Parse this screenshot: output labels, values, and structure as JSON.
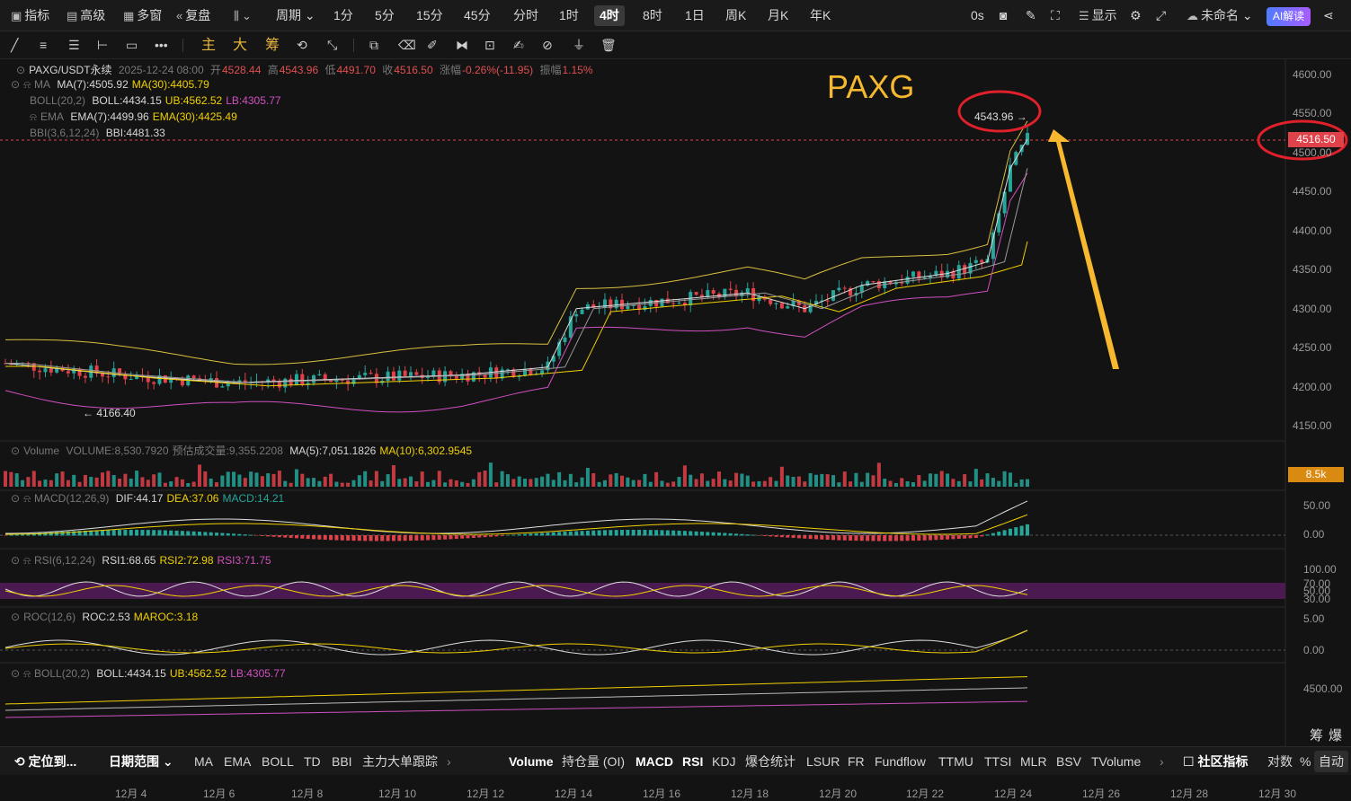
{
  "topbar": {
    "indicators": "指标",
    "advanced": "高级",
    "multi": "多窗",
    "replay": "复盘",
    "period": "周期",
    "intervals": [
      "1分",
      "5分",
      "15分",
      "45分",
      "分时",
      "1时",
      "4时",
      "8时",
      "1日",
      "周K",
      "月K",
      "年K"
    ],
    "active_interval": "4时",
    "zero_s": "0s",
    "display": "显示",
    "layout_name": "未命名",
    "ai": "AI解读"
  },
  "toolbar": {
    "main": "主",
    "big": "大",
    "chip": "筹"
  },
  "header": {
    "symbol": "PAXG/USDT永续",
    "datetime": "2025-12-24 08:00",
    "open_label": "开",
    "open": "4528.44",
    "high_label": "高",
    "high": "4543.96",
    "low_label": "低",
    "low": "4491.70",
    "close_label": "收",
    "close": "4516.50",
    "change_label": "涨幅",
    "change": "-0.26%(-11.95)",
    "amp_label": "振幅",
    "amp": "1.15%"
  },
  "legends": {
    "ma": {
      "name": "MA",
      "ma7": "MA(7):4505.92",
      "ma30": "MA(30):4405.79"
    },
    "boll": {
      "name": "BOLL(20,2)",
      "mid": "BOLL:4434.15",
      "ub": "UB:4562.52",
      "lb": "LB:4305.77"
    },
    "ema": {
      "name": "EMA",
      "ema7": "EMA(7):4499.96",
      "ema30": "EMA(30):4425.49"
    },
    "bbi": {
      "name": "BBI(3,6,12,24)",
      "val": "BBI:4481.33"
    },
    "volume": {
      "name": "Volume",
      "val": "VOLUME:8,530.7920",
      "est": "预估成交量:9,355.2208",
      "ma5": "MA(5):7,051.1826",
      "ma10": "MA(10):6,302.9545"
    },
    "macd": {
      "name": "MACD(12,26,9)",
      "dif": "DIF:44.17",
      "dea": "DEA:37.06",
      "macd": "MACD:14.21"
    },
    "rsi": {
      "name": "RSI(6,12,24)",
      "r1": "RSI1:68.65",
      "r2": "RSI2:72.98",
      "r3": "RSI3:71.75"
    },
    "roc": {
      "name": "ROC(12,6)",
      "roc": "ROC:2.53",
      "maroc": "MAROC:3.18"
    },
    "boll2": {
      "name": "BOLL(20,2)",
      "mid": "BOLL:4434.15",
      "ub": "UB:4562.52",
      "lb": "LB:4305.77"
    }
  },
  "annotation": {
    "label": "PAXG",
    "high_mark": "4543.96",
    "low_mark": "4166.40"
  },
  "price_axis": [
    "4600.00",
    "4550.00",
    "4500.00",
    "4450.00",
    "4400.00",
    "4350.00",
    "4300.00",
    "4250.00",
    "4200.00",
    "4150.00"
  ],
  "current_price": "4516.50",
  "vol_tag": "8.5k",
  "macd_axis": [
    "50.00",
    "0.00"
  ],
  "rsi_axis": [
    "100.00",
    "70.00",
    "50.00",
    "30.00"
  ],
  "roc_axis": [
    "5.00",
    "0.00"
  ],
  "boll_axis": [
    "4500.00"
  ],
  "x_axis": [
    "12月 4",
    "12月 6",
    "12月 8",
    "12月 10",
    "12月 12",
    "12月 14",
    "12月 16",
    "12月 18",
    "12月 20",
    "12月 22",
    "12月 24",
    "12月 26",
    "12月 28",
    "12月 30"
  ],
  "bottombar": {
    "locate": "定位到...",
    "date_range": "日期范围",
    "main_inds": [
      "MA",
      "EMA",
      "BOLL",
      "TD",
      "BBI",
      "主力大单跟踪"
    ],
    "sub_inds": [
      "Volume",
      "持仓量 (OI)",
      "MACD",
      "RSI",
      "KDJ",
      "爆仓统计",
      "LSUR",
      "FR",
      "Fundflow",
      "TTMU",
      "TTSI",
      "MLR",
      "BSV",
      "TVolume"
    ],
    "community": "社区指标",
    "log": "对数",
    "pct": "%",
    "auto": "自动",
    "chip": "筹",
    "liq": "爆"
  },
  "colors": {
    "up": "#26a69a",
    "down": "#e0424a",
    "annot": "#f5b82e",
    "circle": "#e0202a"
  }
}
